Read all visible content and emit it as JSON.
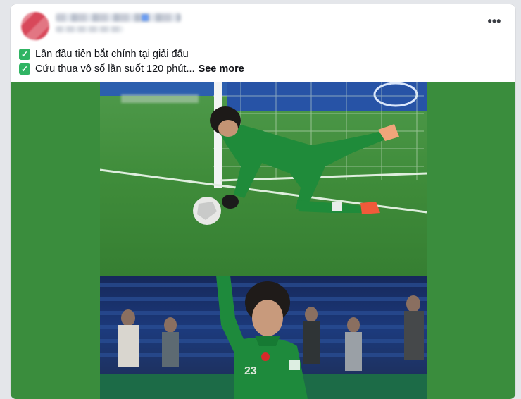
{
  "post": {
    "more_icon": "more-horizontal-icon",
    "caption_lines": [
      {
        "icon": "check-mark-button-icon",
        "text": "Lần đầu tiên bắt chính tại giải đấu"
      },
      {
        "icon": "check-mark-button-icon",
        "text": "Cứu thua vô số lần suốt 120 phút..."
      }
    ],
    "see_more_label": "See more",
    "more_label": "•••",
    "check_glyph": "✓"
  },
  "media": {
    "jersey_number": "23",
    "background_color": "#3a8d3d",
    "jersey_color": "#1e8a3c",
    "pitch_color": "#3f8c3a",
    "stadium_color": "#1c3a7c"
  }
}
